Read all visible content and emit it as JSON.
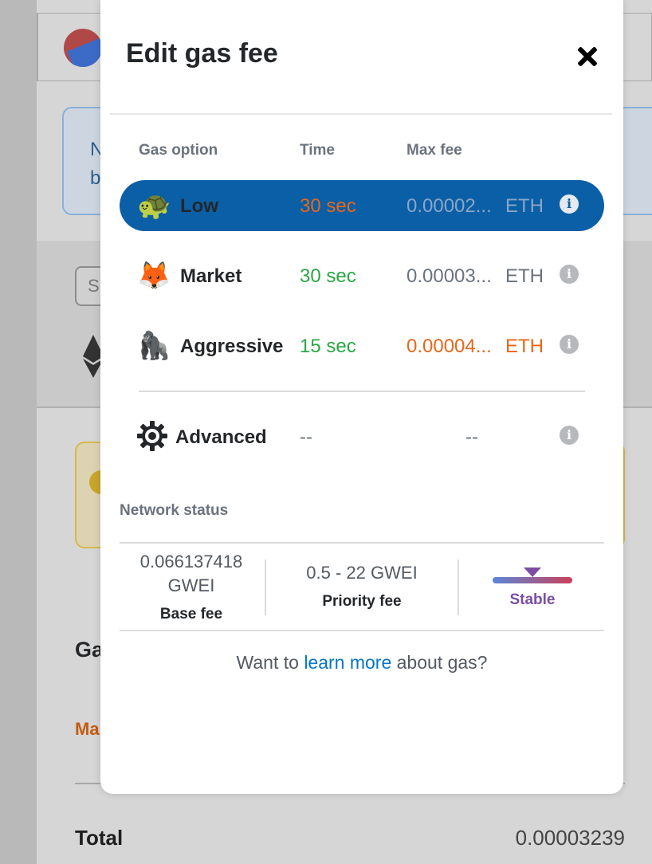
{
  "background": {
    "info_text_line1": "N",
    "info_text_line2": "b",
    "search_placeholder": "S",
    "gas_heading": "Ga",
    "max_label": "Ma",
    "total_label": "Total",
    "total_value": "0.00003239"
  },
  "modal": {
    "title": "Edit gas fee",
    "columns": {
      "option": "Gas option",
      "time": "Time",
      "max_fee": "Max fee"
    },
    "options": [
      {
        "emoji": "🐢",
        "name": "Low",
        "time": "30 sec",
        "fee": "0.00002...",
        "unit": "ETH",
        "selected": true
      },
      {
        "emoji": "🦊",
        "name": "Market",
        "time": "30 sec",
        "fee": "0.00003...",
        "unit": "ETH",
        "selected": false
      },
      {
        "emoji": "🦍",
        "name": "Aggressive",
        "time": "15 sec",
        "fee": "0.00004...",
        "unit": "ETH",
        "selected": false
      }
    ],
    "advanced": {
      "name": "Advanced",
      "time": "--",
      "fee": "--"
    },
    "network_status": {
      "title": "Network status",
      "base_fee_line1": "0.066137418",
      "base_fee_line2": "GWEI",
      "base_fee_label": "Base fee",
      "priority_fee_value": "0.5 - 22 GWEI",
      "priority_fee_label": "Priority fee",
      "trend_label": "Stable"
    },
    "learn": {
      "prefix": "Want to",
      "link": "learn more",
      "suffix": "about gas?"
    },
    "info_glyph": "i"
  },
  "colors": {
    "selected_row": "#0a5fa6",
    "slow_time": "#e8671a",
    "fast_time": "#28a745",
    "link": "#0376c9",
    "stable": "#7b4ea3"
  }
}
